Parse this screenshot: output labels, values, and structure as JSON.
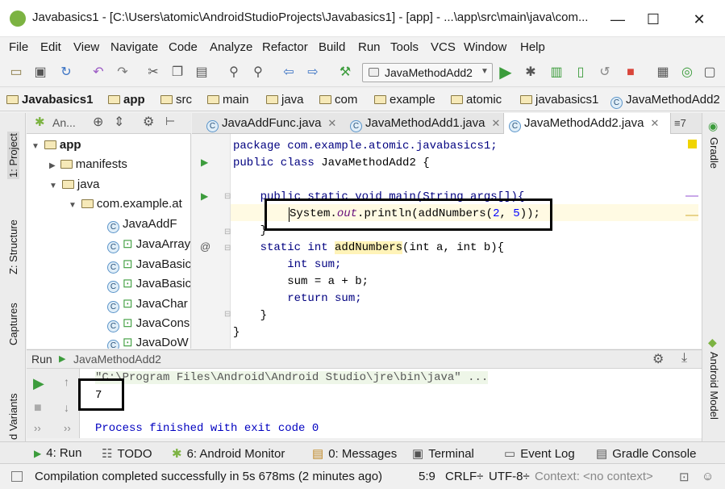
{
  "window": {
    "title": "Javabasics1 - [C:\\Users\\atomic\\AndroidStudioProjects\\Javabasics1] - [app] - ...\\app\\src\\main\\java\\com...",
    "minimize": "—",
    "maximize": "☐",
    "close": "✕"
  },
  "menu": [
    "File",
    "Edit",
    "View",
    "Navigate",
    "Code",
    "Analyze",
    "Refactor",
    "Build",
    "Run",
    "Tools",
    "VCS",
    "Window",
    "Help"
  ],
  "toolbar": {
    "run_config": "JavaMethodAdd2"
  },
  "breadcrumb": [
    "Javabasics1",
    "app",
    "src",
    "main",
    "java",
    "com",
    "example",
    "atomic",
    "javabasics1",
    "JavaMethodAdd2"
  ],
  "left_strip": {
    "project": "1: Project",
    "structure": "Z: Structure",
    "captures": "Captures",
    "variants": "d Variants"
  },
  "right_strip": {
    "gradle": "Gradle",
    "android_model": "Android Model"
  },
  "project_panel": {
    "dropdown": "An...",
    "tree": {
      "app": "app",
      "manifests": "manifests",
      "java": "java",
      "package": "com.example.at",
      "classes": [
        "JavaAddF",
        "JavaArray",
        "JavaBasic",
        "JavaBasic",
        "JavaChar",
        "JavaCons",
        "JavaDoW"
      ]
    }
  },
  "tabs": [
    {
      "label": "JavaAddFunc.java",
      "active": false
    },
    {
      "label": "JavaMethodAdd1.java",
      "active": false
    },
    {
      "label": "JavaMethodAdd2.java",
      "active": true
    }
  ],
  "tab_overflow": "≡7",
  "code": {
    "line1": "package com.example.atomic.javabasics1;",
    "line2a": "public class",
    "line2b": " JavaMethodAdd2 {",
    "line3": "    public static void main(String args[]){",
    "line4a": "System",
    "line4b": ".",
    "line4c": "out",
    "line4d": ".println(addNumbers(",
    "line4e": "2",
    "line4f": ", ",
    "line4g": "5",
    "line4h": "));",
    "line5": "    }",
    "line6a": "    static int ",
    "line6b": "addNumbers",
    "line6c": "(int a, int b){",
    "line7": "        int sum;",
    "line8": "        sum = a + b;",
    "line9": "        return sum;",
    "line10": "    }",
    "line11": "}"
  },
  "run_panel": {
    "label": "Run",
    "config": "JavaMethodAdd2",
    "command": "\"C:\\Program Files\\Android\\Android Studio\\jre\\bin\\java\" ...",
    "output": "7",
    "finish": "Process finished with exit code 0"
  },
  "bottom_tabs": [
    "4: Run",
    "TODO",
    "6: Android Monitor",
    "0: Messages",
    "Terminal",
    "Event Log",
    "Gradle Console"
  ],
  "status": {
    "message": "Compilation completed successfully in 5s 678ms (2 minutes ago)",
    "position": "5:9",
    "line_sep": "CRLF÷",
    "encoding": "UTF-8÷",
    "context": "Context: <no context>"
  },
  "colors": {
    "run_green": "#3c9c3c",
    "keyword": "#000080",
    "field": "#660e7a",
    "number": "#0000ff",
    "stop_red": "#d9453a"
  }
}
